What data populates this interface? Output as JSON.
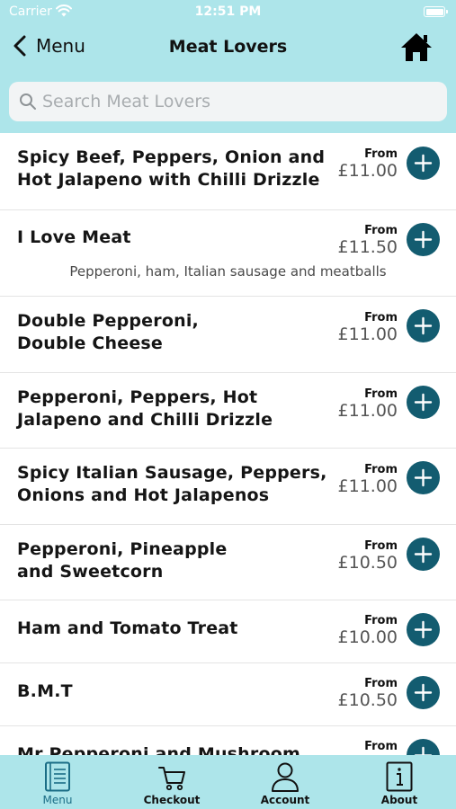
{
  "status_bar": {
    "carrier": "Carrier",
    "time": "12:51 PM"
  },
  "nav": {
    "back_label": "Menu",
    "title": "Meat Lovers"
  },
  "search": {
    "placeholder": "Search Meat Lovers",
    "value": ""
  },
  "items": [
    {
      "name": "Spicy Beef, Peppers, Onion and\nHot Jalapeno with Chilli Drizzle",
      "desc": "",
      "from": "From",
      "price": "£11.00"
    },
    {
      "name": "I Love Meat",
      "desc": "Pepperoni, ham, Italian sausage and meatballs",
      "from": "From",
      "price": "£11.50"
    },
    {
      "name": "Double Pepperoni,\nDouble Cheese",
      "desc": "",
      "from": "From",
      "price": "£11.00"
    },
    {
      "name": "Pepperoni, Peppers, Hot\nJalapeno and Chilli Drizzle",
      "desc": "",
      "from": "From",
      "price": "£11.00"
    },
    {
      "name": "Spicy Italian Sausage, Peppers,\nOnions and Hot Jalapenos",
      "desc": "",
      "from": "From",
      "price": "£11.00"
    },
    {
      "name": "Pepperoni, Pineapple\nand Sweetcorn",
      "desc": "",
      "from": "From",
      "price": "£10.50"
    },
    {
      "name": "Ham and Tomato Treat",
      "desc": "",
      "from": "From",
      "price": "£10.00"
    },
    {
      "name": "B.M.T",
      "desc": "",
      "from": "From",
      "price": "£10.50"
    },
    {
      "name": "Mr Pepperoni and Mushroom",
      "desc": "",
      "from": "From",
      "price": ""
    }
  ],
  "tabs": [
    {
      "label": "Menu",
      "icon": "menu-book-icon",
      "active": true
    },
    {
      "label": "Checkout",
      "icon": "cart-icon",
      "active": false
    },
    {
      "label": "Account",
      "icon": "person-icon",
      "active": false
    },
    {
      "label": "About",
      "icon": "info-icon",
      "active": false
    }
  ],
  "colors": {
    "header_bg": "#ade5ea",
    "accent": "#135c70",
    "active_tab": "#1b6d86"
  }
}
